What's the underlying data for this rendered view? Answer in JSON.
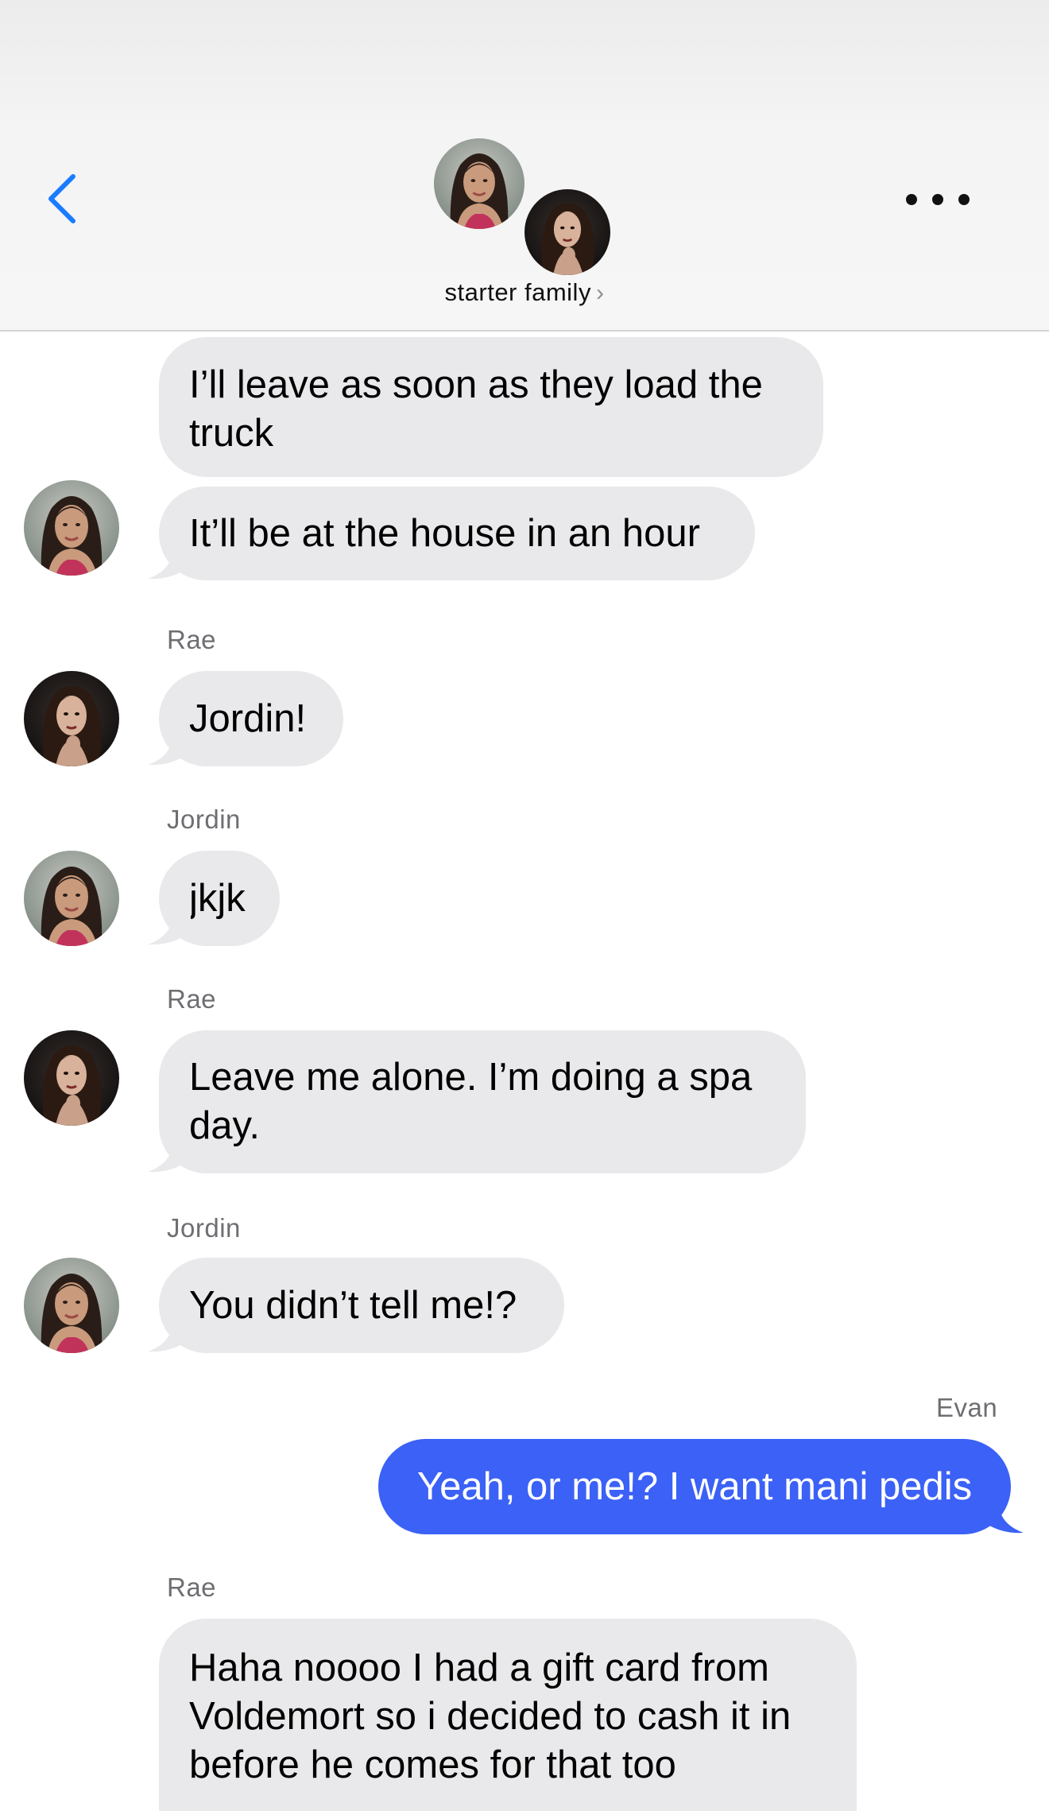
{
  "header": {
    "title": "starter family",
    "chevron": "›",
    "back_icon": "chevron-left-icon",
    "more_icon": "ellipsis-icon"
  },
  "colors": {
    "accent": "#1a7cff",
    "outgoing_bubble": "#3b61f6",
    "incoming_bubble": "#e9e9eb",
    "sender_label": "#6e6e73"
  },
  "messages": [
    {
      "sender": "",
      "text_lines": [
        "I’ll leave as soon as they load the",
        "truck"
      ],
      "direction": "incoming"
    },
    {
      "sender": "",
      "text_lines": [
        "It’ll be at the house in an hour"
      ],
      "direction": "incoming"
    },
    {
      "sender": "Rae",
      "text_lines": [
        "Jordin!"
      ],
      "direction": "incoming"
    },
    {
      "sender": "Jordin",
      "text_lines": [
        "jkjk"
      ],
      "direction": "incoming"
    },
    {
      "sender": "Rae",
      "text_lines": [
        "Leave me alone. I’m doing a spa",
        "day."
      ],
      "direction": "incoming"
    },
    {
      "sender": "Jordin",
      "text_lines": [
        "You didn’t tell me!?"
      ],
      "direction": "incoming"
    },
    {
      "sender": "Evan",
      "text_lines": [
        "Yeah, or me!? I want mani pedis"
      ],
      "direction": "outgoing"
    },
    {
      "sender": "Rae",
      "text_lines": [
        "Haha noooo I had a gift card from",
        "Voldemort so i decided to cash it in",
        "before he comes for that too"
      ],
      "direction": "incoming"
    }
  ]
}
